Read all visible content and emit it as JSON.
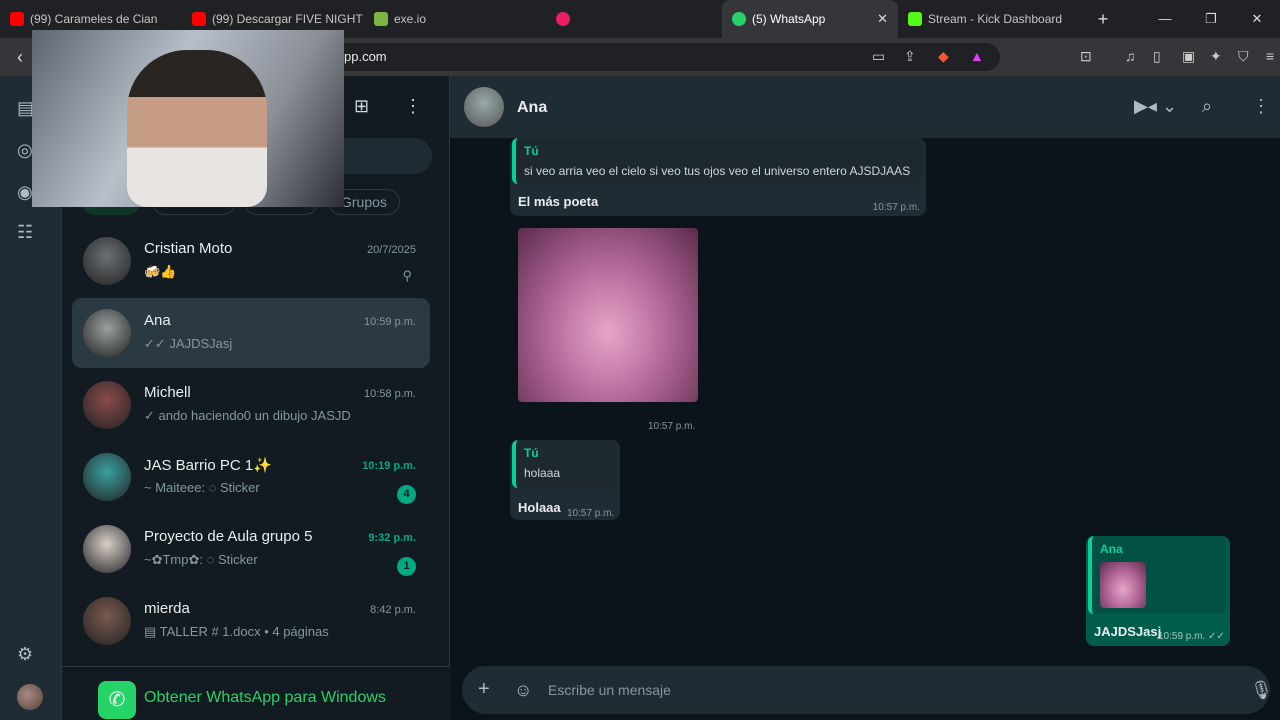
{
  "browser": {
    "tabs": [
      {
        "label": "(99) Carameles de Cian",
        "color": "#ff0000"
      },
      {
        "label": "(99) Descargar FIVE NIGHT",
        "color": "#ff0000"
      },
      {
        "label": "exe.io",
        "color": "#7cb342"
      },
      {
        "label": "",
        "color": "#e91e63"
      },
      {
        "label": "(5) WhatsApp",
        "color": "#25d366"
      },
      {
        "label": "Stream - Kick Dashboard",
        "color": "#53fc18"
      }
    ],
    "url": "pp.com"
  },
  "chatlist": {
    "chips": [
      "",
      "",
      "",
      "Grupos"
    ],
    "chats": [
      {
        "name": "Cristian Moto",
        "preview": "🍻👍",
        "time": "20/7/2025",
        "pinned": true,
        "color": "#6b7075"
      },
      {
        "name": "Ana",
        "preview": "✓✓ JAJDSJasj",
        "time": "10:59 p.m.",
        "selected": true,
        "color": "#9aa0a0"
      },
      {
        "name": "Michell",
        "preview": "✓ ando haciendo0 un dibujo JASJD",
        "time": "10:58 p.m.",
        "color": "#8a4b4b"
      },
      {
        "name": "JAS Barrio PC 1✨",
        "preview": "~ Maiteee: ◌ Sticker",
        "time": "10:19 p.m.",
        "badge": "4",
        "green": true,
        "color": "#3aa0a0"
      },
      {
        "name": "Proyecto de Aula grupo 5",
        "preview": "~✿Tmp✿: ◌ Sticker",
        "time": "9:32 p.m.",
        "badge": "1",
        "green": true,
        "color": "#d8d0c8"
      },
      {
        "name": "mierda",
        "preview": "▤ TALLER # 1.docx • 4 páginas",
        "time": "8:42 p.m.",
        "color": "#7a5a50"
      }
    ],
    "get_app": "Obtener WhatsApp para Windows"
  },
  "conversation": {
    "contact": "Ana",
    "msg1": {
      "quote_author": "Tú",
      "quote_text": "si veo arria veo el cielo si veo tus ojos veo el universo entero AJSDJAAS",
      "text": "El más poeta",
      "time": "10:57 p.m."
    },
    "msg2": {
      "time": "10:57 p.m."
    },
    "msg3": {
      "quote_author": "Tú",
      "quote_text": "holaaa",
      "text": "Holaaa",
      "time": "10:57 p.m."
    },
    "msg4": {
      "quote_author": "Ana",
      "text": "JAJDSJasj",
      "time": "10:59 p.m. ✓✓"
    },
    "placeholder": "Escribe un mensaje"
  }
}
